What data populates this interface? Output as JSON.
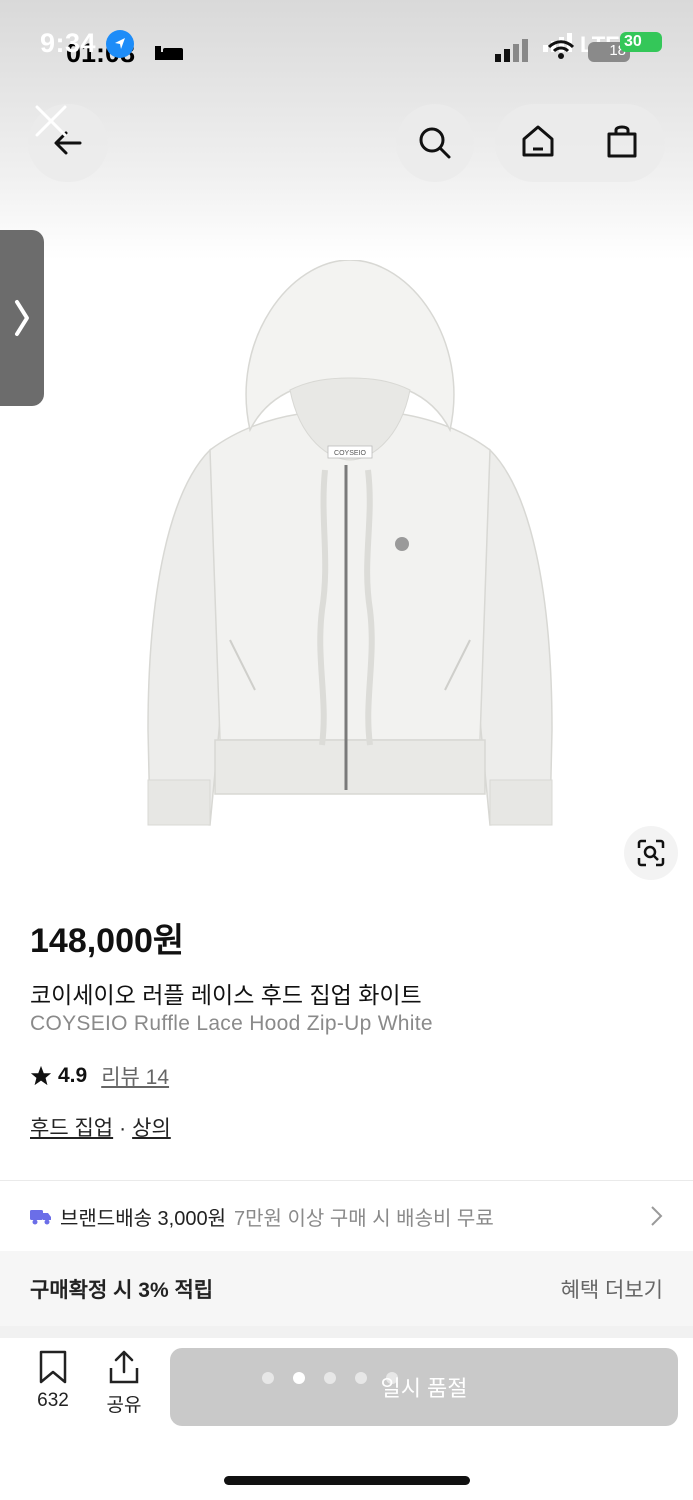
{
  "status_bar": {
    "time": "9:34",
    "time_ghost": "01:08",
    "network": "LTE",
    "battery": "30",
    "battery_ghost": "18"
  },
  "nav": {
    "back_icon": "arrow-left-icon",
    "close_icon": "close-icon",
    "search_icon": "search-icon",
    "home_icon": "home-icon",
    "cart_icon": "shopping-bag-icon",
    "side_tab_icon": "chevron-right-icon",
    "lens_icon": "visual-search-icon"
  },
  "product": {
    "image_tag": "COYSEIO",
    "price": "148,000원",
    "title_ko": "코이세이오 러플 레이스 후드 집업 화이트",
    "title_en": "COYSEIO Ruffle Lace Hood Zip-Up White",
    "rating": "4.9",
    "review_label": "리뷰 14",
    "category_1": "후드 집업",
    "category_sep": "·",
    "category_2": "상의"
  },
  "shipping": {
    "main": "브랜드배송 3,000원",
    "sub": "7만원 이상 구매 시 배송비 무료"
  },
  "benefit": {
    "left": "구매확정 시 3% 적립",
    "right": "혜택 더보기"
  },
  "bottom_bar": {
    "save_count": "632",
    "share_label": "공유",
    "buy_label": "일시 품절",
    "carousel_dots": 5,
    "carousel_active": 2
  },
  "colors": {
    "accent_truck": "#6b6ee8",
    "sold_out_button": "#c9c9c9",
    "battery": "#34c759"
  }
}
